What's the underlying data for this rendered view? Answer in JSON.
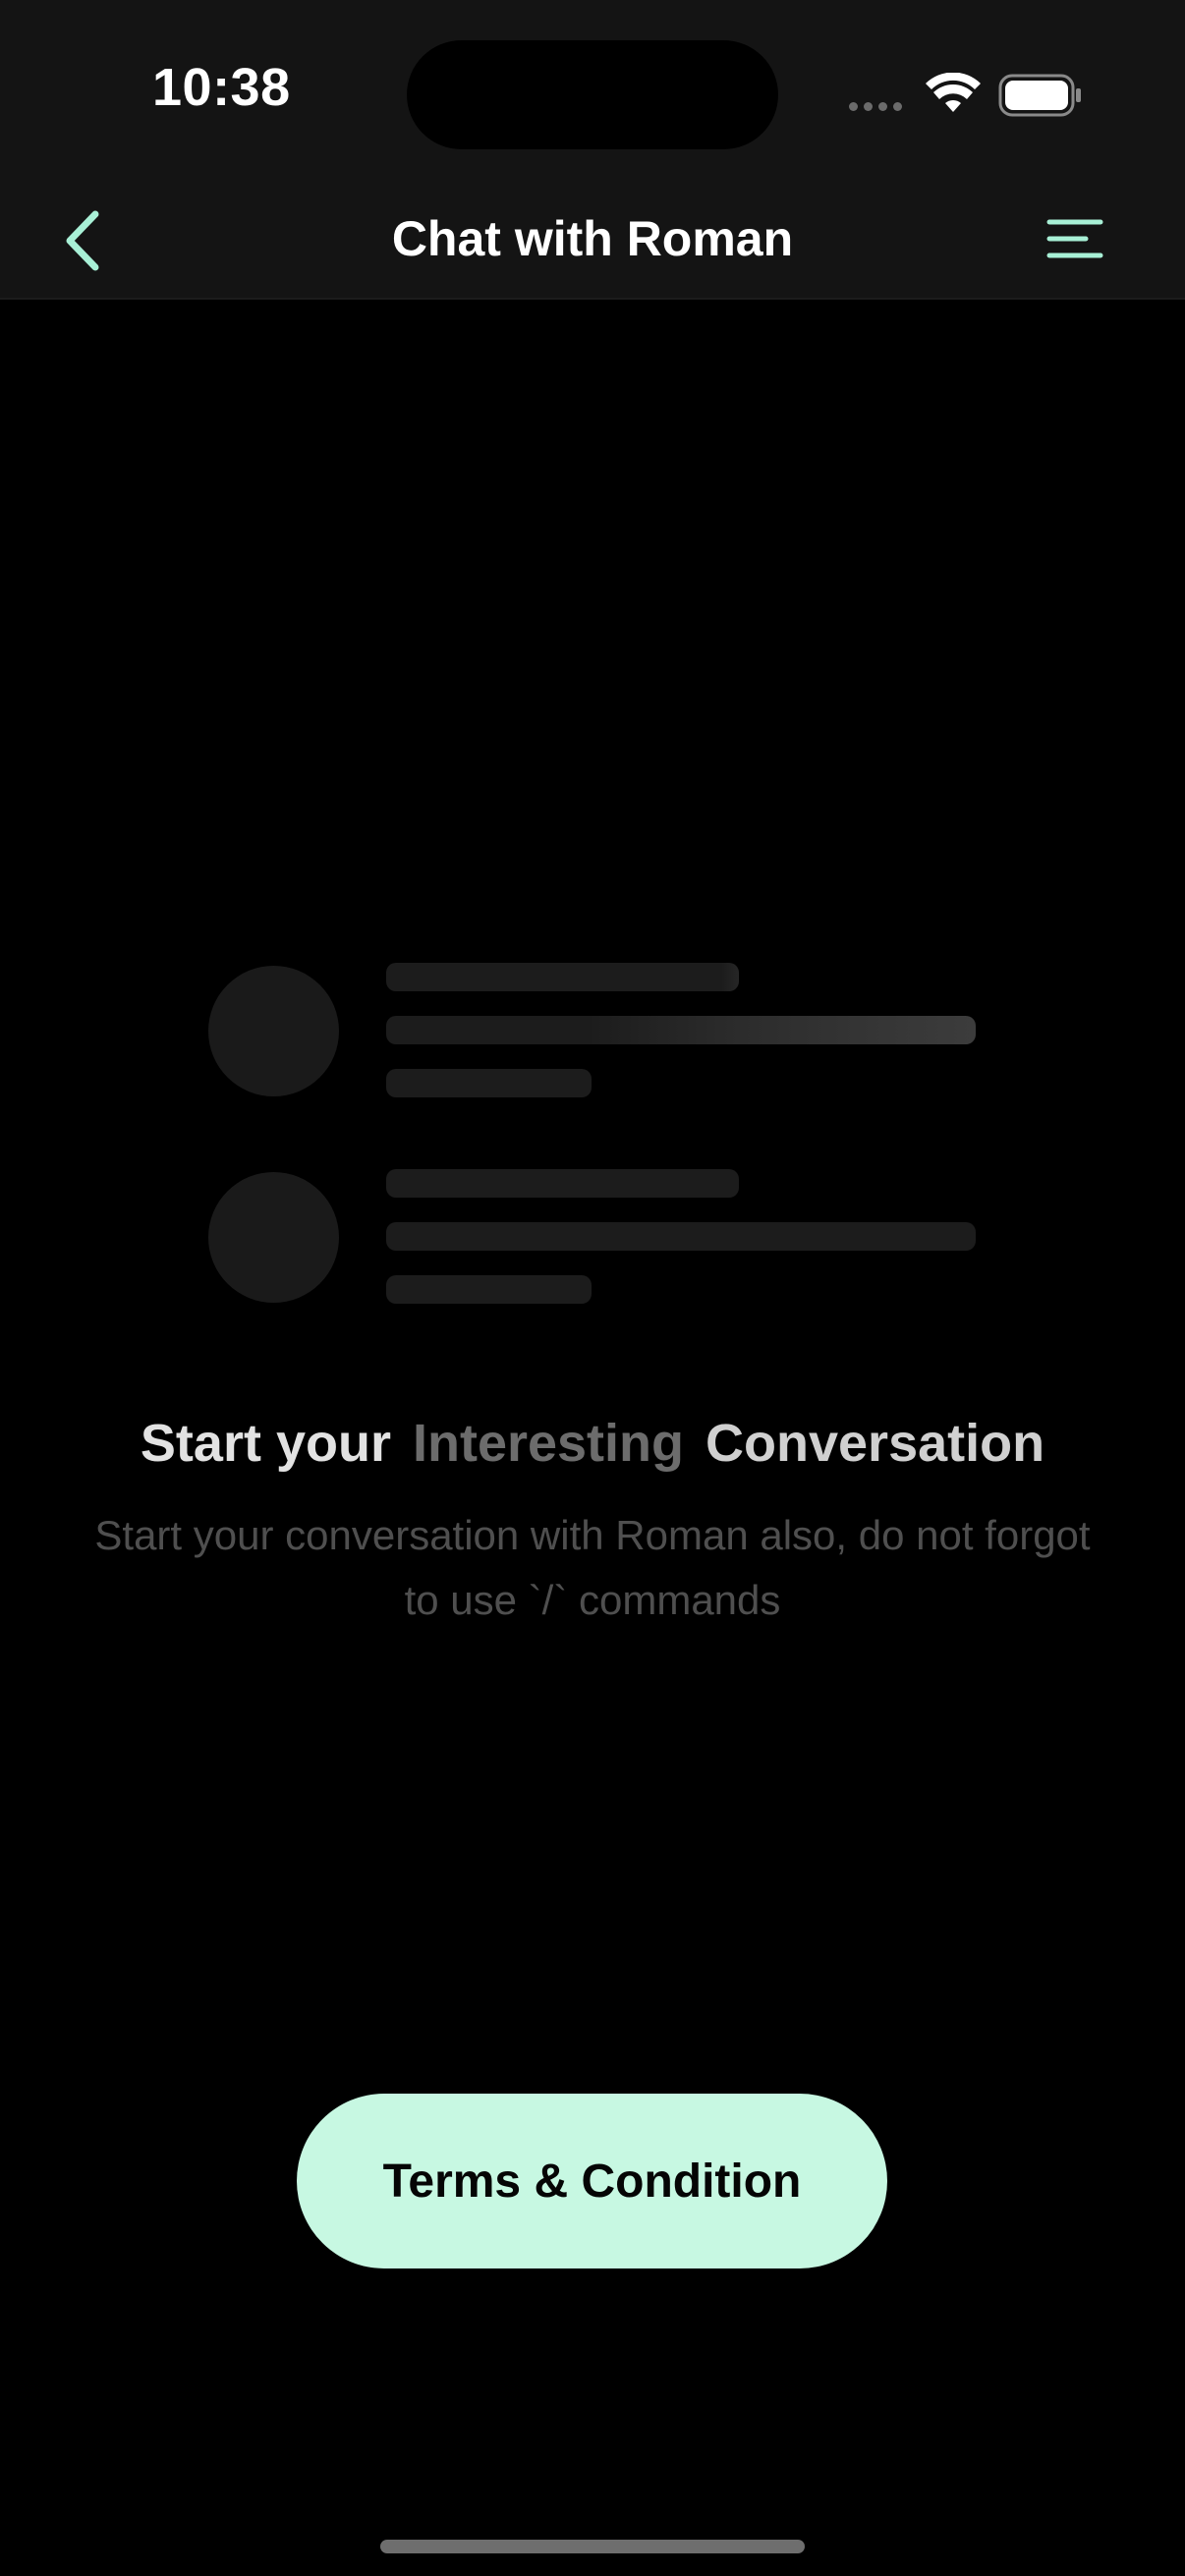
{
  "status_bar": {
    "time": "10:38",
    "wifi_icon": "wifi-icon",
    "battery_icon": "battery-icon"
  },
  "header": {
    "title": "Chat with Roman",
    "back_icon": "chevron-left-icon",
    "menu_icon": "menu-icon"
  },
  "empty_state": {
    "title_part1": "Start your",
    "title_part2": "Interesting",
    "title_part3": "Conversation",
    "subtitle": "Start your conversation with Roman also, do not forgot to use `/` commands"
  },
  "actions": {
    "terms_label": "Terms & Condition"
  },
  "colors": {
    "accent": "#c7f8e2",
    "icon_accent": "#a8f0d6",
    "header_bg": "#141414",
    "background": "#000000"
  }
}
